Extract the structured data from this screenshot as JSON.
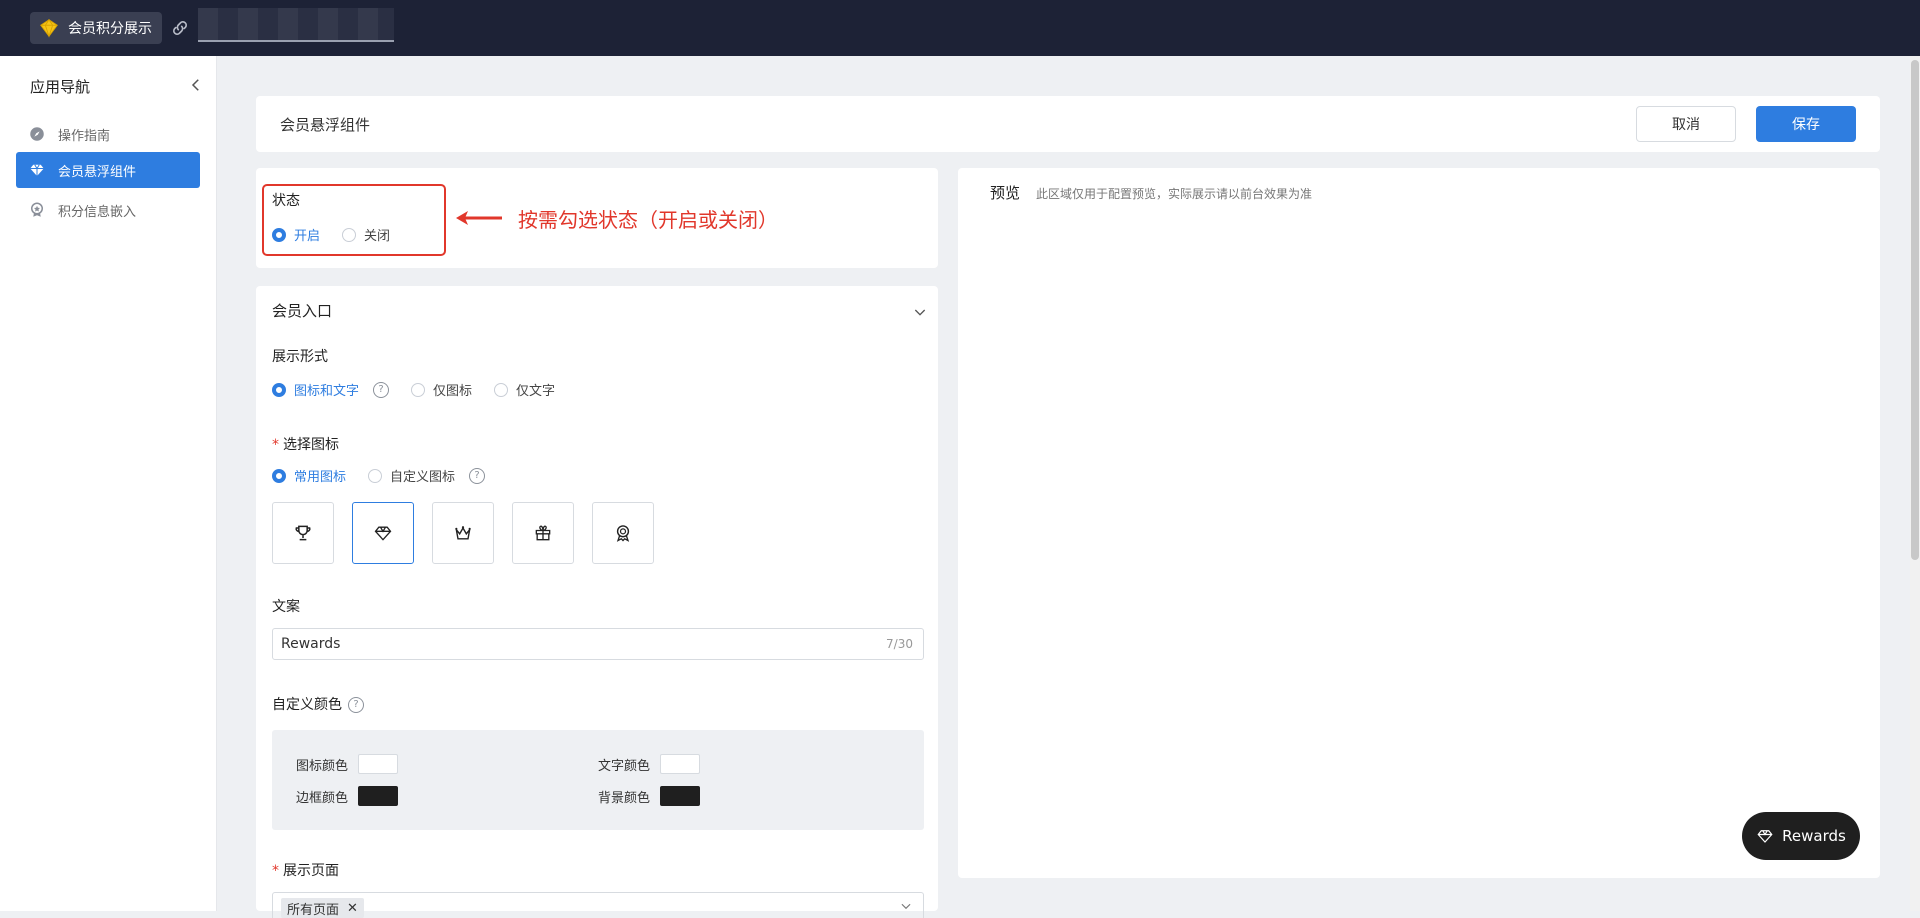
{
  "topbar": {
    "app_name": "会员积分展示"
  },
  "sidebar": {
    "title": "应用导航",
    "items": [
      {
        "label": "操作指南",
        "icon": "compass-icon",
        "active": false
      },
      {
        "label": "会员悬浮组件",
        "icon": "diamond-icon",
        "active": true
      },
      {
        "label": "积分信息嵌入",
        "icon": "badge-icon",
        "active": false
      }
    ]
  },
  "header": {
    "title": "会员悬浮组件",
    "cancel_label": "取消",
    "save_label": "保存"
  },
  "status": {
    "label": "状态",
    "options": [
      "开启",
      "关闭"
    ],
    "selected": "开启",
    "annotation": "按需勾选状态（开启或关闭）"
  },
  "entry": {
    "section_title": "会员入口",
    "display_form": {
      "label": "展示形式",
      "options": [
        "图标和文字",
        "仅图标",
        "仅文字"
      ],
      "selected": "图标和文字"
    },
    "icon_choice": {
      "label": "选择图标",
      "options": [
        "常用图标",
        "自定义图标"
      ],
      "selected": "常用图标",
      "icons": [
        "trophy-icon",
        "diamond-icon",
        "crown-icon",
        "gift-icon",
        "medal-icon"
      ],
      "selected_icon": "diamond-icon"
    },
    "copy": {
      "label": "文案",
      "value": "Rewards",
      "counter": "7/30"
    },
    "custom_color": {
      "label": "自定义颜色",
      "icon_color_label": "图标颜色",
      "text_color_label": "文字颜色",
      "border_color_label": "边框颜色",
      "bg_color_label": "背景颜色",
      "icon_color": "#ffffff",
      "text_color": "#ffffff",
      "border_color": "#1f1f1f",
      "bg_color": "#1f1f1f"
    },
    "display_page": {
      "label": "展示页面",
      "tag": "所有页面"
    }
  },
  "preview": {
    "label": "预览",
    "note": "此区域仅用于配置预览，实际展示请以前台效果为准",
    "button_label": "Rewards"
  },
  "colors": {
    "accent": "#2e7de0",
    "topbar": "#1d2236",
    "annotation": "#e1372b"
  }
}
